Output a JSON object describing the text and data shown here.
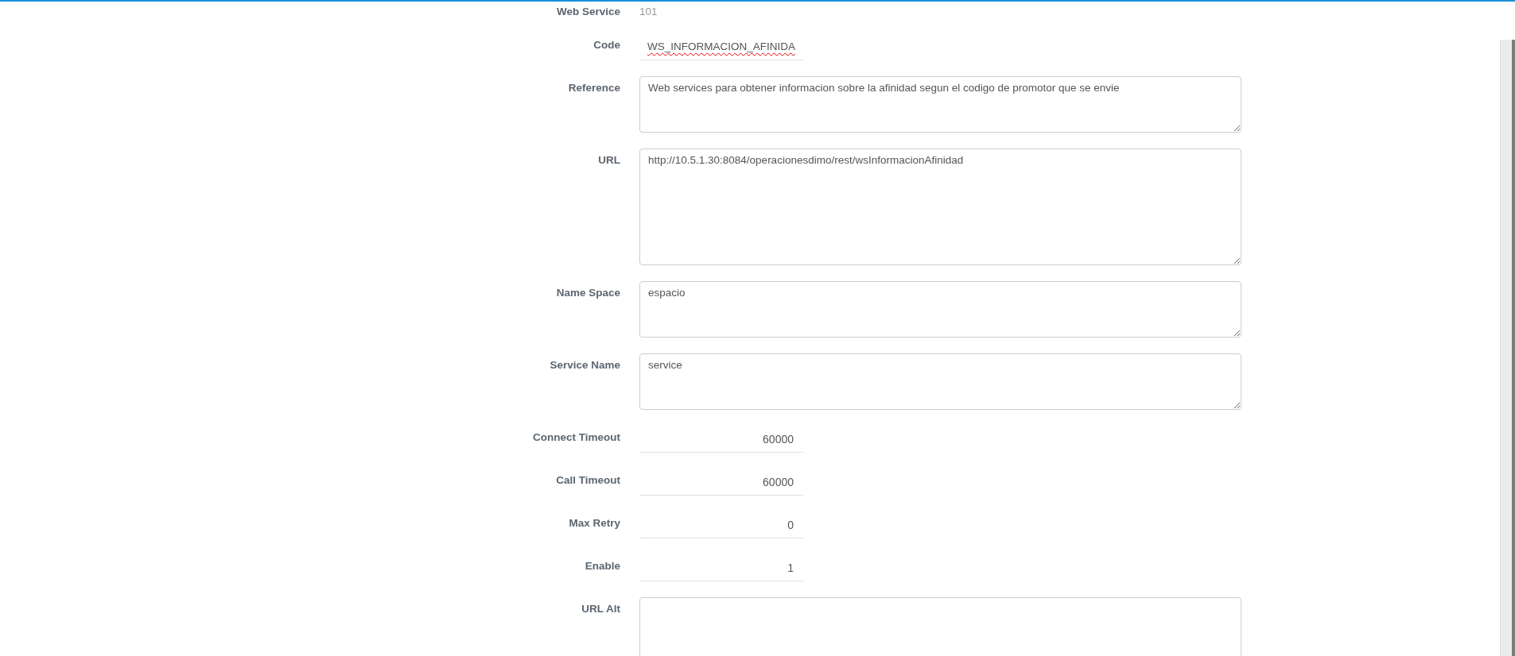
{
  "fields": [
    {
      "label": "Web Service",
      "kind": "static",
      "value": "101"
    },
    {
      "label": "Code",
      "kind": "input",
      "value": "WS_INFORMACION_AFINIDA",
      "spellcheck_error": true
    },
    {
      "label": "Reference",
      "kind": "textarea",
      "value": "Web services para obtener informacion sobre la afinidad segun el codigo de promotor que se envie"
    },
    {
      "label": "URL",
      "kind": "textarea-large",
      "value": "http://10.5.1.30:8084/operacionesdimo/rest/wsInformacionAfinidad"
    },
    {
      "label": "Name Space",
      "kind": "textarea",
      "value": "espacio"
    },
    {
      "label": "Service Name",
      "kind": "textarea",
      "value": "service"
    },
    {
      "label": "Connect Timeout",
      "kind": "number",
      "value": "60000"
    },
    {
      "label": "Call Timeout",
      "kind": "number",
      "value": "60000"
    },
    {
      "label": "Max Retry",
      "kind": "number",
      "value": "0"
    },
    {
      "label": "Enable",
      "kind": "number",
      "value": "1"
    },
    {
      "label": "URL Alt",
      "kind": "textarea-large"
    }
  ]
}
